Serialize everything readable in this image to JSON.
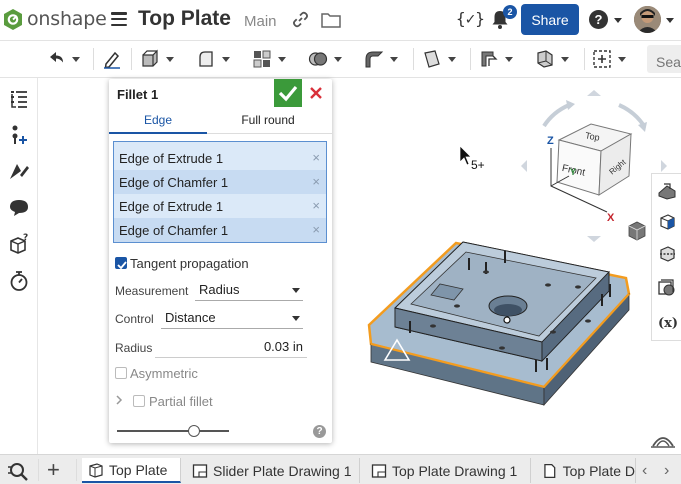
{
  "header": {
    "logo_text": "onshape",
    "doc_title": "Top Plate",
    "doc_branch": "Main",
    "variable_studio_label": "{✓}",
    "notification_count": "2",
    "share_label": "Share",
    "help_label": "?"
  },
  "toolbar": {
    "search_placeholder": "Sea"
  },
  "panel": {
    "title": "Fillet 1",
    "tabs": [
      {
        "label": "Edge"
      },
      {
        "label": "Full round"
      }
    ],
    "selections": [
      {
        "label": "Edge of Extrude 1"
      },
      {
        "label": "Edge of Chamfer 1"
      },
      {
        "label": "Edge of Extrude 1"
      },
      {
        "label": "Edge of Chamfer 1"
      }
    ],
    "remove_glyph": "×",
    "tangent_label": "Tangent propagation",
    "measurement_label": "Measurement",
    "measurement_value": "Radius",
    "control_label": "Control",
    "control_value": "Distance",
    "radius_label": "Radius",
    "radius_value": "0.03 in",
    "asymmetric_label": "Asymmetric",
    "partial_label": "Partial fillet",
    "help_glyph": "?"
  },
  "viewcube": {
    "top": "Top",
    "front": "Front",
    "right": "Right",
    "axis_x": "X",
    "axis_y": "Y",
    "axis_z": "Z"
  },
  "cursor_badge": "5+",
  "bottom_tabs": [
    {
      "label": "Top Plate"
    },
    {
      "label": "Slider Plate Drawing 1"
    },
    {
      "label": "Top Plate Drawing 1"
    },
    {
      "label": "Top Plate D"
    }
  ],
  "bottom_add": "+",
  "nav_prev": "‹",
  "nav_next": "›",
  "colors": {
    "brand_blue": "#1a55a5",
    "ok_green": "#3b9a3a",
    "cancel_red": "#d9303a",
    "selection_bg": "#dbe9f8",
    "edge_highlight": "#f39c1f"
  }
}
